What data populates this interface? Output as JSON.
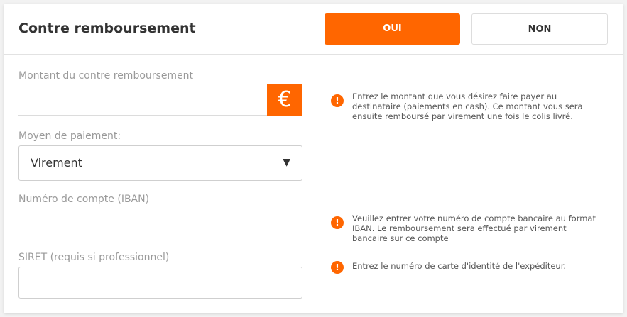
{
  "header": {
    "title": "Contre remboursement",
    "yes_label": "OUI",
    "no_label": "NON"
  },
  "fields": {
    "amount": {
      "label": "Montant du contre remboursement",
      "value": "",
      "currency_symbol": "€",
      "help": "Entrez le montant que vous désirez faire payer au destinataire (paiements en cash). Ce montant vous sera ensuite remboursé par virement une fois le colis livré."
    },
    "payment": {
      "label": "Moyen de paiement:",
      "selected": "Virement",
      "caret": "▼"
    },
    "iban": {
      "label": "Numéro de compte (IBAN)",
      "value": "",
      "help": "Veuillez entrer votre numéro de compte bancaire au format IBAN. Le remboursement sera effectué par virement bancaire sur ce compte"
    },
    "siret": {
      "label": "SIRET (requis si professionnel)",
      "value": "",
      "help": "Entrez le numéro de carte d'identité de l'expéditeur."
    }
  },
  "icons": {
    "info_glyph": "!"
  },
  "colors": {
    "accent": "#ff6600",
    "text": "#333333",
    "muted": "#9a9a9a"
  }
}
